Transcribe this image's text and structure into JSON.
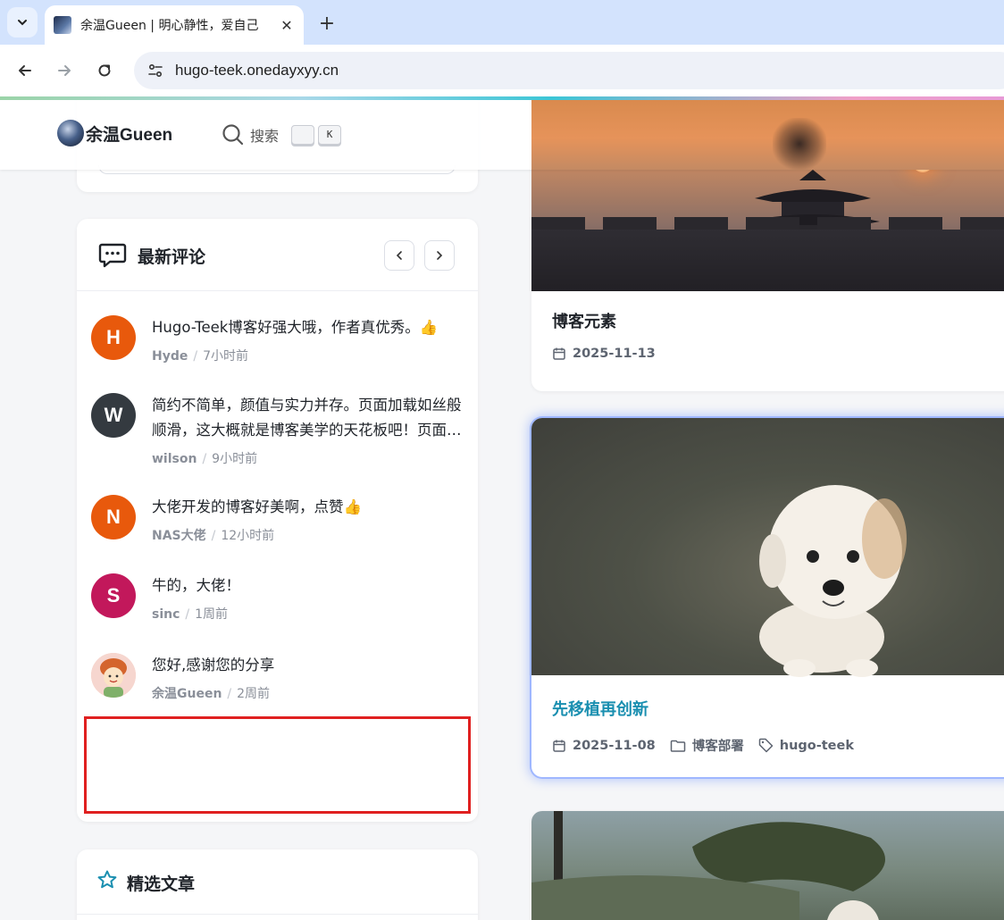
{
  "browser": {
    "tab_title": "余温Gueen | 明心静性，爱自己",
    "url": "hugo-teek.onedayxyy.cn"
  },
  "header": {
    "logo_text": "余温Gueen",
    "search_label": "搜索",
    "shortcut_key": "K"
  },
  "comments": {
    "title": "最新评论",
    "items": [
      {
        "avatar_letter": "H",
        "avatar_color": "#e8590c",
        "text": "Hugo-Teek博客好强大哦，作者真优秀。👍",
        "author": "Hyde",
        "time": "7小时前"
      },
      {
        "avatar_letter": "W",
        "avatar_color": "#343a40",
        "text": "简约不简单，颜值与实力并存。页面加载如丝般顺滑，这大概就是博客美学的天花板吧！页面设计非常用心",
        "author": "wilson",
        "time": "9小时前"
      },
      {
        "avatar_letter": "N",
        "avatar_color": "#e8590c",
        "text": "大佬开发的博客好美啊，点赞👍",
        "author": "NAS大佬",
        "time": "12小时前"
      },
      {
        "avatar_letter": "S",
        "avatar_color": "#c2185b",
        "text": "牛的，大佬！",
        "author": "sinc",
        "time": "1周前"
      },
      {
        "avatar_letter": "",
        "avatar_color": "#f4c7b8",
        "text": "您好,感谢您的分享",
        "author": "余温Gueen",
        "time": "2周前"
      }
    ],
    "separator": "/"
  },
  "featured": {
    "title": "精选文章"
  },
  "posts": [
    {
      "title": "博客元素",
      "date": "2025-11-13"
    },
    {
      "title": "先移植再创新",
      "date": "2025-11-08",
      "category": "博客部署",
      "tag": "hugo-teek"
    }
  ]
}
